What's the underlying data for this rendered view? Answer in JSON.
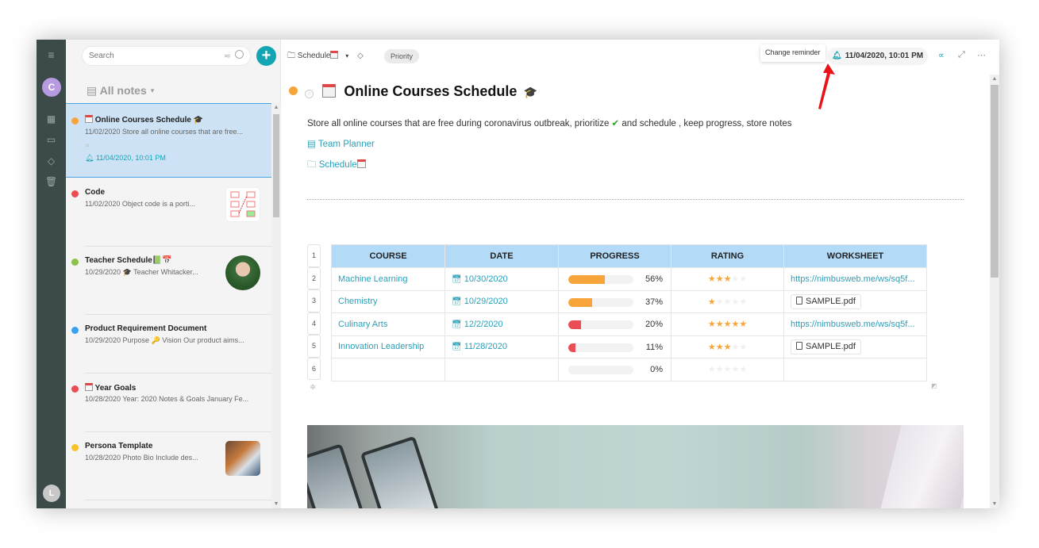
{
  "rail": {
    "menu_icon": "hamburger-menu-icon",
    "user_initial": "C",
    "bottom_user_initial": "L",
    "nav": [
      {
        "name": "dashboard",
        "icon": "grid-icon"
      },
      {
        "name": "folders",
        "icon": "folder-icon"
      },
      {
        "name": "tags",
        "icon": "tag-icon"
      },
      {
        "name": "trash",
        "icon": "trash-icon"
      }
    ]
  },
  "notes_list": {
    "search_placeholder": "Search",
    "add_label": "+",
    "header_label": "All notes",
    "header_caret": "▾",
    "notes": [
      {
        "title": "Online Courses Schedule 🎓",
        "has_cal_icon": true,
        "snippet": "11/02/2020 Store all online courses that are free...",
        "dot_color": "#f7a53a",
        "selected": true,
        "reminder": "11/04/2020, 10:01 PM",
        "shared": true
      },
      {
        "title": "Code",
        "snippet": "11/02/2020 Object code is a porti...",
        "dot_color": "#ea4d53",
        "thumb": "code-diagram"
      },
      {
        "title": "Teacher Schedule📗📅",
        "snippet": "10/29/2020 🎓 Teacher Whitacker...",
        "dot_color": "#8bc34a",
        "thumb": "portrait"
      },
      {
        "title": "Product Requirement Document",
        "snippet": "10/29/2020 Purpose 🔑 Vision Our product aims...",
        "dot_color": "#3ba1ef"
      },
      {
        "title": "Year Goals",
        "has_cal_icon": true,
        "snippet": "10/28/2020 Year: 2020 Notes & Goals January Fe...",
        "dot_color": "#ea4d53"
      },
      {
        "title": "Persona Template",
        "snippet": "10/28/2020 Photo Bio Include des...",
        "dot_color": "#f9c22a",
        "thumb": "persona-photo"
      }
    ]
  },
  "editor": {
    "breadcrumb_folder": "Schedule",
    "breadcrumb_caret": "▾",
    "tag": "Priority",
    "tooltip": "Change reminder",
    "reminder": "11/04/2020, 10:01 PM",
    "title": "Online Courses Schedule",
    "title_suffix": "🎓",
    "status_color": "#f7a53a",
    "description_before": "Store all online courses that are free during coronavirus outbreak, prioritize ",
    "description_check": "✔",
    "description_after": " and schedule , keep progress, store notes",
    "links": [
      {
        "label": "Team Planner",
        "icon": "note-icon",
        "glyph": "▤"
      },
      {
        "label": "Schedule",
        "icon": "folder-icon",
        "glyph": "🗀"
      }
    ],
    "table": {
      "row_numbers": [
        "1",
        "2",
        "3",
        "4",
        "5",
        "6"
      ],
      "headers": [
        "COURSE",
        "DATE",
        "PROGRESS",
        "RATING",
        "WORKSHEET"
      ],
      "rows": [
        {
          "course": "Machine Learning",
          "date": "10/30/2020",
          "progress": 56,
          "progress_label": "56%",
          "progress_color": "#f7a53a",
          "rating": 3,
          "worksheet_type": "link",
          "worksheet": "https://nimbusweb.me/ws/sq5f..."
        },
        {
          "course": "Chemistry",
          "date": "10/29/2020",
          "progress": 37,
          "progress_label": "37%",
          "progress_color": "#f7a53a",
          "rating": 1,
          "worksheet_type": "file",
          "worksheet": "SAMPLE.pdf"
        },
        {
          "course": "Culinary Arts",
          "date": "12/2/2020",
          "progress": 20,
          "progress_label": "20%",
          "progress_color": "#ea4d53",
          "rating": 5,
          "worksheet_type": "link",
          "worksheet": "https://nimbusweb.me/ws/sq5f..."
        },
        {
          "course": "Innovation Leadership",
          "date": "11/28/2020",
          "progress": 11,
          "progress_label": "11%",
          "progress_color": "#ea4d53",
          "rating": 3,
          "worksheet_type": "file",
          "worksheet": "SAMPLE.pdf"
        },
        {
          "course": "",
          "date": "",
          "progress": 0,
          "progress_label": "0%",
          "progress_color": "#f7a53a",
          "rating": 0,
          "worksheet_type": "none",
          "worksheet": ""
        }
      ],
      "max_rating": 5
    }
  },
  "colors": {
    "accent": "#14a5b5",
    "selected_note_bg": "#cde2f5",
    "table_header_bg": "#b3dbf8",
    "rail_bg": "#3d4a4a",
    "annotation_arrow": "#e8141a"
  }
}
